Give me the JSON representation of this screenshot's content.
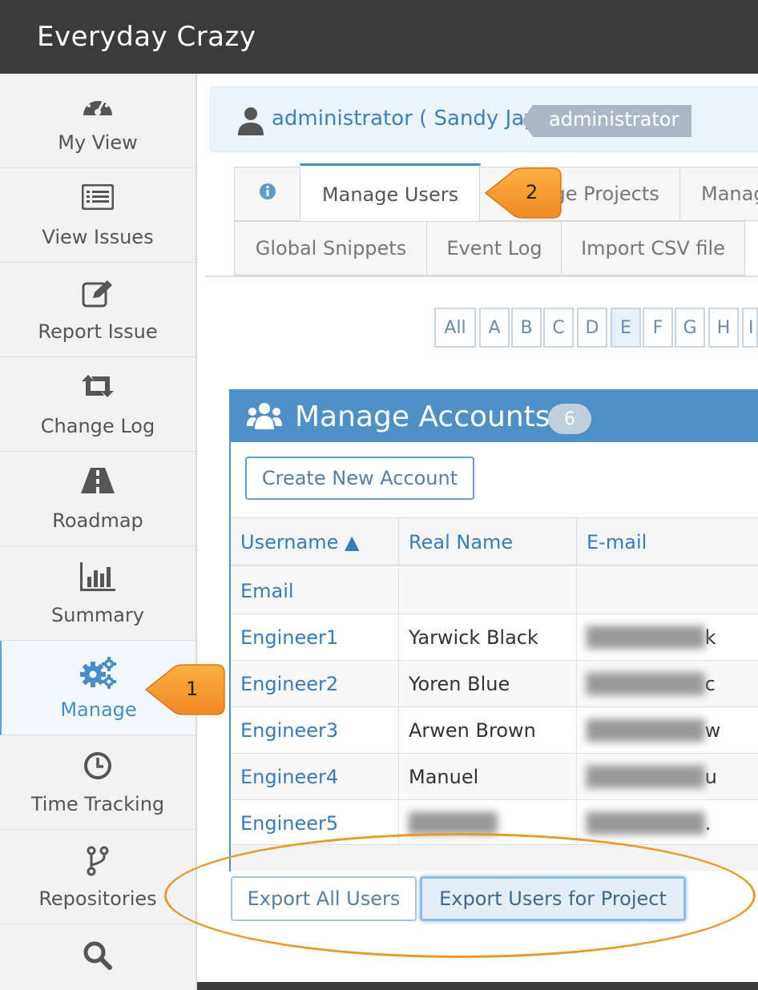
{
  "app": {
    "title": "Everyday Crazy"
  },
  "sidebar": {
    "items": [
      {
        "label": "My View",
        "icon": "dashboard-icon"
      },
      {
        "label": "View Issues",
        "icon": "list-icon"
      },
      {
        "label": "Report Issue",
        "icon": "edit-icon"
      },
      {
        "label": "Change Log",
        "icon": "retweet-icon"
      },
      {
        "label": "Roadmap",
        "icon": "road-icon"
      },
      {
        "label": "Summary",
        "icon": "bar-chart-icon"
      },
      {
        "label": "Manage",
        "icon": "gears-icon",
        "active": true
      },
      {
        "label": "Time Tracking",
        "icon": "clock-icon"
      },
      {
        "label": "Repositories",
        "icon": "code-fork-icon"
      },
      {
        "label": "",
        "icon": "search-icon"
      }
    ]
  },
  "user": {
    "name": "administrator ( Sandy Jay )",
    "role_badge": "administrator"
  },
  "tabs": {
    "row1": [
      "",
      "Manage Users",
      "Manage Projects",
      "Manag"
    ],
    "row2": [
      "Global Snippets",
      "Event Log",
      "Import CSV file"
    ]
  },
  "letters": [
    "All",
    "A",
    "B",
    "C",
    "D",
    "E",
    "F",
    "G",
    "H",
    "I"
  ],
  "active_letter": "E",
  "accounts": {
    "title": "Manage Accounts",
    "count": "6",
    "create_button": "Create New Account",
    "columns": [
      "Username ▲",
      "Real Name",
      "E-mail"
    ],
    "rows": [
      {
        "username": "Email",
        "real_name": "",
        "email": ""
      },
      {
        "username": "Engineer1",
        "real_name": "Yarwick Black",
        "email": "k"
      },
      {
        "username": "Engineer2",
        "real_name": "Yoren Blue",
        "email": "c"
      },
      {
        "username": "Engineer3",
        "real_name": "Arwen Brown",
        "email": "w"
      },
      {
        "username": "Engineer4",
        "real_name": "Manuel",
        "email": "u"
      },
      {
        "username": "Engineer5",
        "real_name": "",
        "email": "."
      }
    ]
  },
  "export": {
    "all_users": "Export All Users",
    "users_for_project": "Export Users for Project"
  },
  "callouts": {
    "first": "1",
    "second": "2"
  },
  "colors": {
    "accent": "#4f90c6",
    "callout": "#f28c28",
    "topbar": "#3b3b3b"
  }
}
